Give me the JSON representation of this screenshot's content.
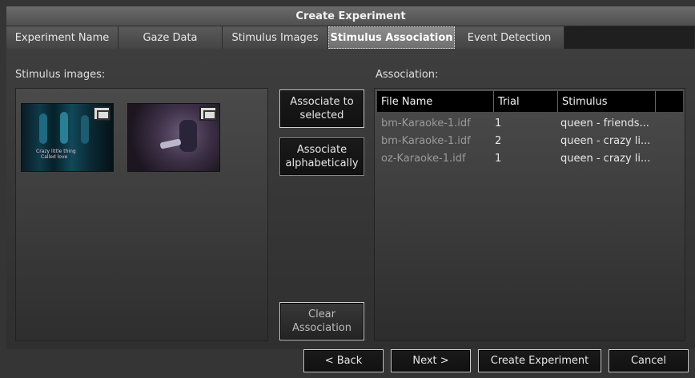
{
  "window": {
    "title": "Create Experiment"
  },
  "tabs": [
    {
      "label": "Experiment Name",
      "active": false
    },
    {
      "label": "Gaze Data",
      "active": false
    },
    {
      "label": "Stimulus Images",
      "active": false
    },
    {
      "label": "Stimulus Association",
      "active": true
    },
    {
      "label": "Event Detection",
      "active": false
    }
  ],
  "stimulus_panel": {
    "label": "Stimulus images:",
    "thumbnails": [
      {
        "icon": "film-icon",
        "caption_line1": "Crazy little thing",
        "caption_line2": "Called love"
      },
      {
        "icon": "film-icon"
      }
    ]
  },
  "actions": {
    "associate_selected": "Associate to selected",
    "associate_alpha": "Associate alphabetically",
    "clear": "Clear Association"
  },
  "association": {
    "label": "Association:",
    "columns": [
      "File Name",
      "Trial",
      "Stimulus"
    ],
    "rows": [
      {
        "file": "bm-Karaoke-1.idf",
        "trial": "1",
        "stimulus": "queen - friends..."
      },
      {
        "file": "bm-Karaoke-1.idf",
        "trial": "2",
        "stimulus": "queen - crazy li..."
      },
      {
        "file": "oz-Karaoke-1.idf",
        "trial": "1",
        "stimulus": "queen - crazy li..."
      }
    ]
  },
  "footer": {
    "back": "< Back",
    "next": "Next >",
    "create": "Create Experiment",
    "cancel": "Cancel"
  }
}
